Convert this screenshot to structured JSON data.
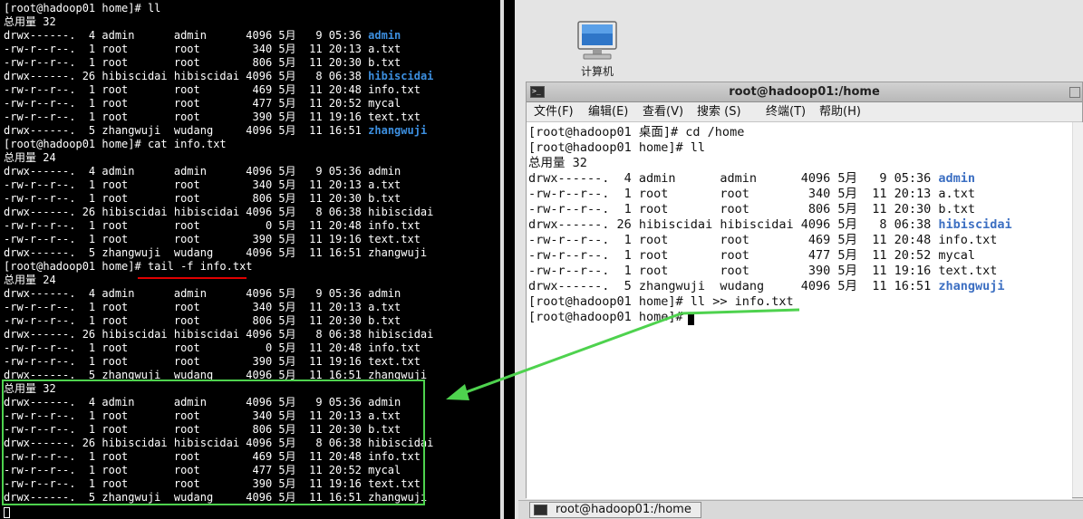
{
  "left_terminal": {
    "lines": [
      "[root@hadoop01 home]# ll",
      "总用量 32",
      "drwx------.  4 admin      admin      4096 5月   9 05:36 |admin",
      "-rw-r--r--.  1 root       root        340 5月  11 20:13 a.txt",
      "-rw-r--r--.  1 root       root        806 5月  11 20:30 b.txt",
      "drwx------. 26 hibiscidai hibiscidai 4096 5月   8 06:38 |hibiscidai",
      "-rw-r--r--.  1 root       root        469 5月  11 20:48 info.txt",
      "-rw-r--r--.  1 root       root        477 5月  11 20:52 mycal",
      "-rw-r--r--.  1 root       root        390 5月  11 19:16 text.txt",
      "drwx------.  5 zhangwuji  wudang     4096 5月  11 16:51 |zhangwuji",
      "[root@hadoop01 home]# cat info.txt",
      "总用量 24",
      "drwx------.  4 admin      admin      4096 5月   9 05:36 admin",
      "-rw-r--r--.  1 root       root        340 5月  11 20:13 a.txt",
      "-rw-r--r--.  1 root       root        806 5月  11 20:30 b.txt",
      "drwx------. 26 hibiscidai hibiscidai 4096 5月   8 06:38 hibiscidai",
      "-rw-r--r--.  1 root       root          0 5月  11 20:48 info.txt",
      "-rw-r--r--.  1 root       root        390 5月  11 19:16 text.txt",
      "drwx------.  5 zhangwuji  wudang     4096 5月  11 16:51 zhangwuji",
      "[root@hadoop01 home]# tail -f info.txt",
      "总用量 24",
      "drwx------.  4 admin      admin      4096 5月   9 05:36 admin",
      "-rw-r--r--.  1 root       root        340 5月  11 20:13 a.txt",
      "-rw-r--r--.  1 root       root        806 5月  11 20:30 b.txt",
      "drwx------. 26 hibiscidai hibiscidai 4096 5月   8 06:38 hibiscidai",
      "-rw-r--r--.  1 root       root          0 5月  11 20:48 info.txt",
      "-rw-r--r--.  1 root       root        390 5月  11 19:16 text.txt",
      "drwx------.  5 zhangwuji  wudang     4096 5月  11 16:51 zhangwuji",
      "总用量 32",
      "drwx------.  4 admin      admin      4096 5月   9 05:36 admin",
      "-rw-r--r--.  1 root       root        340 5月  11 20:13 a.txt",
      "-rw-r--r--.  1 root       root        806 5月  11 20:30 b.txt",
      "drwx------. 26 hibiscidai hibiscidai 4096 5月   8 06:38 hibiscidai",
      "-rw-r--r--.  1 root       root        469 5月  11 20:48 info.txt",
      "-rw-r--r--.  1 root       root        477 5月  11 20:52 mycal",
      "-rw-r--r--.  1 root       root        390 5月  11 19:16 text.txt",
      "drwx------.  5 zhangwuji  wudang     4096 5月  11 16:51 zhangwuji"
    ]
  },
  "desktop": {
    "icon_label": "计算机"
  },
  "right_window": {
    "title": "root@hadoop01:/home",
    "menu": [
      "文件(F)",
      "编辑(E)",
      "查看(V)",
      "搜索 (S)",
      "终端(T)",
      "帮助(H)"
    ],
    "lines": [
      "[root@hadoop01 桌面]# cd /home",
      "[root@hadoop01 home]# ll",
      "总用量 32",
      "drwx------.  4 admin      admin      4096 5月   9 05:36 |admin",
      "-rw-r--r--.  1 root       root        340 5月  11 20:13 a.txt",
      "-rw-r--r--.  1 root       root        806 5月  11 20:30 b.txt",
      "drwx------. 26 hibiscidai hibiscidai 4096 5月   8 06:38 |hibiscidai",
      "-rw-r--r--.  1 root       root        469 5月  11 20:48 info.txt",
      "-rw-r--r--.  1 root       root        477 5月  11 20:52 mycal",
      "-rw-r--r--.  1 root       root        390 5月  11 19:16 text.txt",
      "drwx------.  5 zhangwuji  wudang     4096 5月  11 16:51 |zhangwuji",
      "[root@hadoop01 home]# ll >> info.txt",
      "[root@hadoop01 home]# "
    ]
  },
  "taskbar": {
    "item_label": "root@hadoop01:/home"
  },
  "colors": {
    "directory_left": "#3c8fe0",
    "directory_right": "#3c6fc2",
    "highlight_box": "#4ed24e",
    "underline": "#e00000"
  }
}
